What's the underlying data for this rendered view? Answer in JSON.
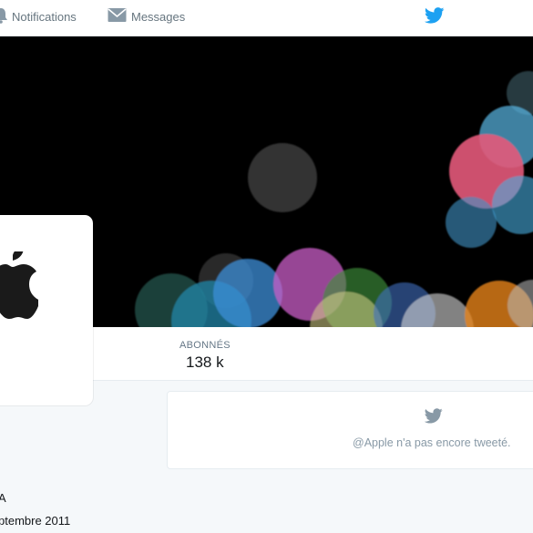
{
  "topbar": {
    "notifications_label": "Notifications",
    "messages_label": "Messages",
    "brand_color": "#1da1f2"
  },
  "stats": {
    "followers_label": "ABONNÉS",
    "followers_value": "138 k"
  },
  "timeline": {
    "empty_message": "@Apple n'a pas encore tweeté."
  },
  "profile": {
    "name_fragment": "A",
    "joined_fragment": "ptembre 2011"
  }
}
